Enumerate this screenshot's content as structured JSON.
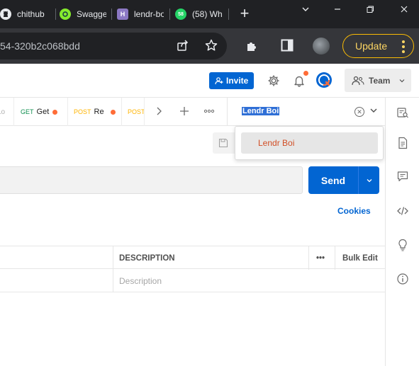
{
  "browser": {
    "tabs": [
      {
        "label": "chithub",
        "icon": "github-icon"
      },
      {
        "label": "Swagge",
        "icon": "swagger-icon"
      },
      {
        "label": "lendr-bo",
        "icon": "heroku-icon"
      },
      {
        "label": "(58) Wh",
        "icon": "whatsapp-icon",
        "badge": "58"
      }
    ],
    "new_tab": "+",
    "url": "54-320b2c068bdd",
    "update_label": "Update"
  },
  "postman": {
    "invite_label": "Invite",
    "team_label": "Team",
    "request_tabs": [
      {
        "method": "",
        "name": "Lo"
      },
      {
        "method": "GET",
        "name": "Get"
      },
      {
        "method": "POST",
        "name": "Re"
      },
      {
        "method": "POST",
        "name": ""
      }
    ],
    "environment": {
      "selected": "Lendr Boi",
      "options": [
        "Lendr Boi"
      ]
    },
    "send_label": "Send",
    "cookies_label": "Cookies",
    "params": {
      "headers": {
        "description": "DESCRIPTION",
        "more": "•••",
        "bulk_edit": "Bulk Edit"
      },
      "row_placeholder": "Description"
    }
  },
  "colors": {
    "accent": "#0265d2",
    "unsaved_dot": "#ff6c37",
    "get_method": "#0f8f4f",
    "post_method": "#ffb400",
    "env_option_text": "#d14e25"
  }
}
